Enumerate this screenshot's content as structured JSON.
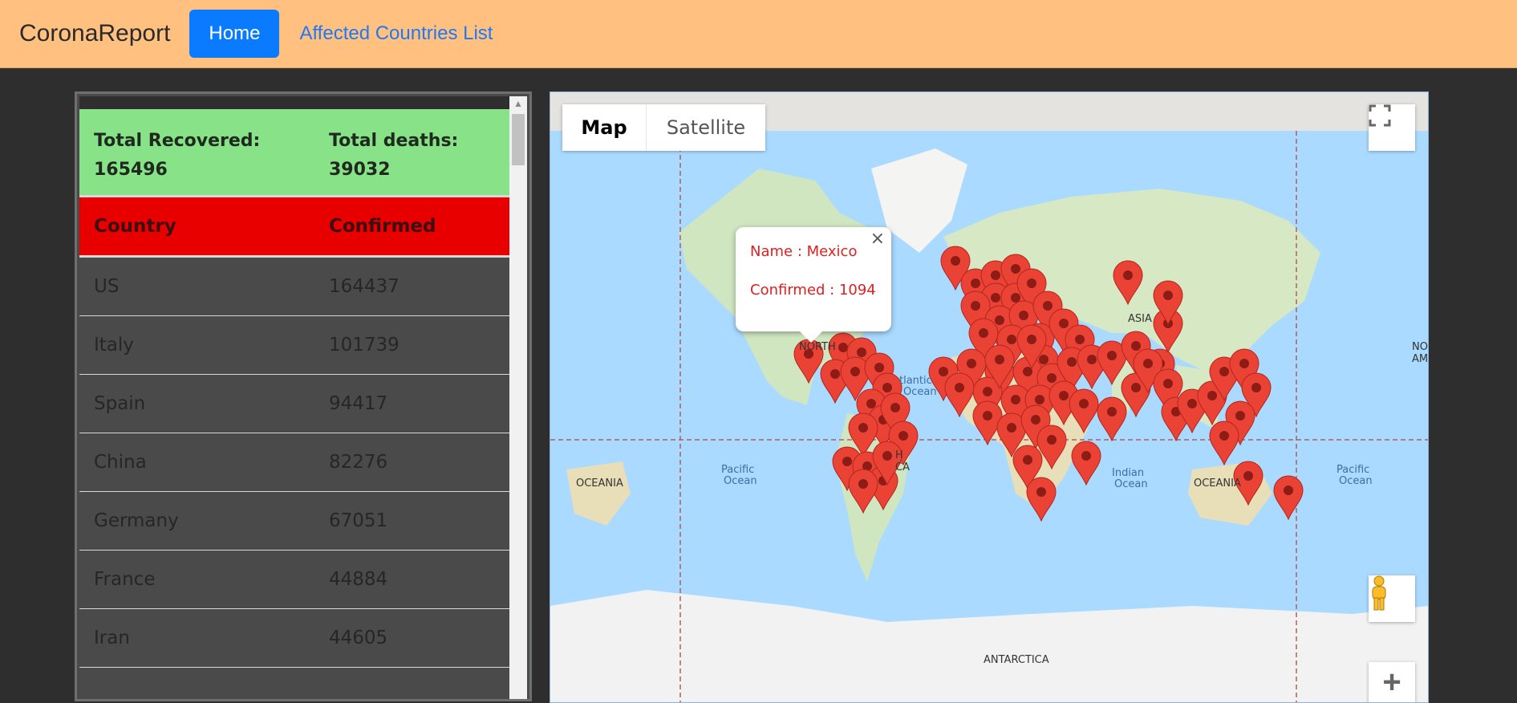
{
  "navbar": {
    "brand": "CoronaReport",
    "home_label": "Home",
    "countries_link": "Affected Countries List"
  },
  "summary": {
    "recovered_label": "Total Recovered:",
    "recovered_value": "165496",
    "deaths_label": "Total deaths:",
    "deaths_value": "39032"
  },
  "table": {
    "headers": [
      "Country",
      "Confirmed"
    ],
    "rows": [
      {
        "country": "US",
        "confirmed": "164437"
      },
      {
        "country": "Italy",
        "confirmed": "101739"
      },
      {
        "country": "Spain",
        "confirmed": "94417"
      },
      {
        "country": "China",
        "confirmed": "82276"
      },
      {
        "country": "Germany",
        "confirmed": "67051"
      },
      {
        "country": "France",
        "confirmed": "44884"
      },
      {
        "country": "Iran",
        "confirmed": "44605"
      }
    ]
  },
  "map": {
    "type_map": "Map",
    "type_satellite": "Satellite",
    "labels": {
      "oceania_left": "OCEANIA",
      "oceania_right": "OCEANIA",
      "asia": "ASIA",
      "antarctica": "ANTARCTICA",
      "north_america": "NORTH",
      "south_america": "H",
      "south_america_2": "CA",
      "north_america_right": "NO",
      "north_america_right_2": "AM",
      "pacific_left": "Pacific",
      "pacific_left_2": "Ocean",
      "pacific_right": "Pacific",
      "pacific_right_2": "Ocean",
      "indian": "Indian",
      "indian_2": "Ocean",
      "atlantic": "tlantic",
      "atlantic_2": "Ocean"
    },
    "infowindow": {
      "name_line": "Name : Mexico",
      "confirmed_line": "Confirmed : 1094"
    },
    "marker_color": "#ea4335"
  }
}
